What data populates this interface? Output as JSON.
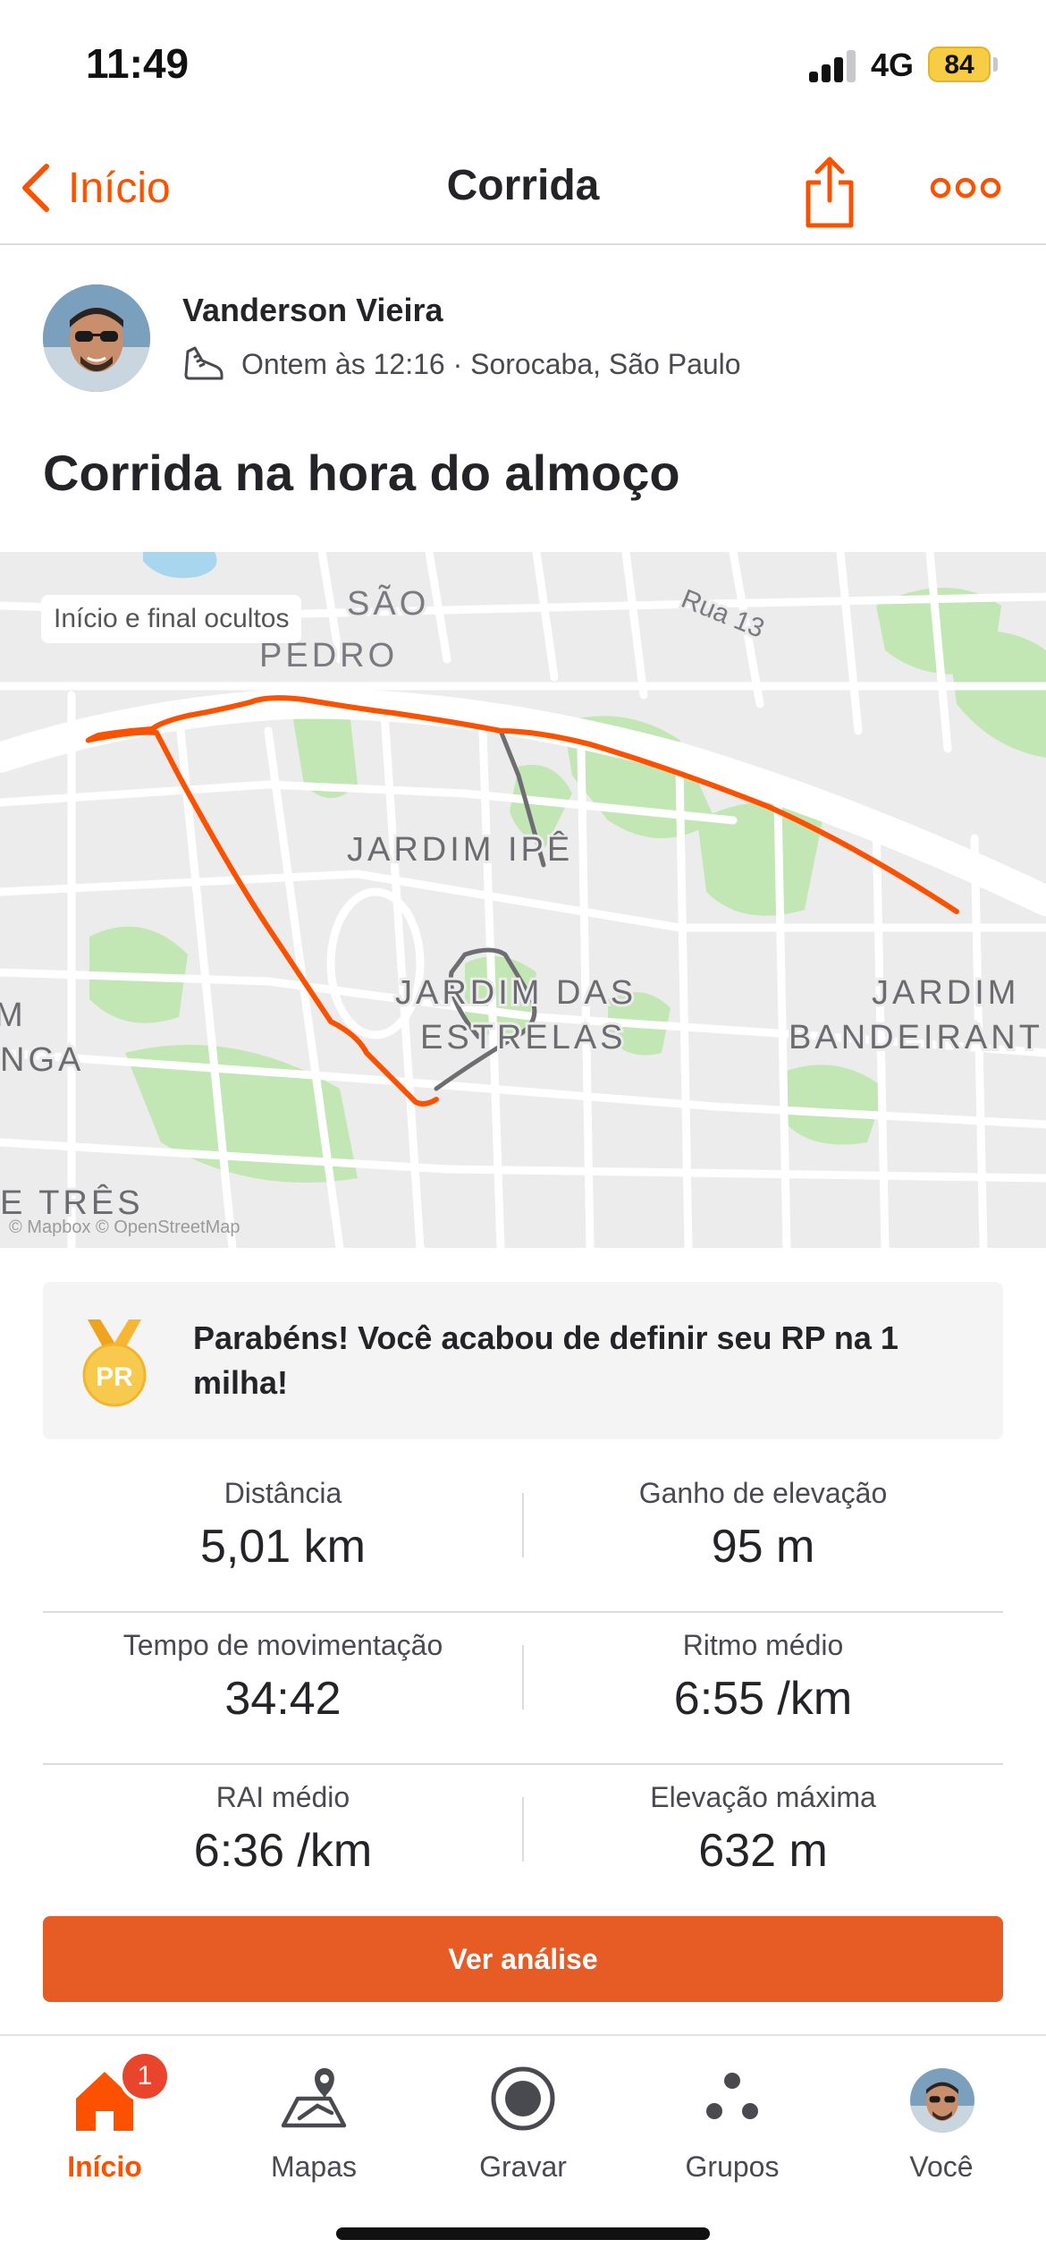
{
  "status_bar": {
    "time": "11:49",
    "network": "4G",
    "battery": "84"
  },
  "nav": {
    "back_label": "Início",
    "title": "Corrida"
  },
  "athlete": {
    "name": "Vanderson Vieira",
    "meta": "Ontem às 12:16 · Sorocaba, São Paulo"
  },
  "activity": {
    "title": "Corrida na hora do almoço"
  },
  "map": {
    "tag": "Início e final ocultos",
    "attribution": "© Mapbox © OpenStreetMap",
    "labels": [
      "SÃO",
      "PEDRO",
      "Rua 13",
      "JARDIM IPÊ",
      "JARDIM DAS",
      "ESTRELAS",
      "JARDIM",
      "BANDEIRANT",
      "M",
      "NGA",
      "E TRÊS"
    ],
    "route_color": "#fc5200"
  },
  "pr": {
    "badge_text": "PR",
    "message": "Parabéns! Você acabou de definir seu RP na 1 milha!"
  },
  "stats": [
    [
      {
        "label": "Distância",
        "value": "5,01 km"
      },
      {
        "label": "Ganho de elevação",
        "value": "95 m"
      }
    ],
    [
      {
        "label": "Tempo de movimentação",
        "value": "34:42"
      },
      {
        "label": "Ritmo médio",
        "value": "6:55 /km"
      }
    ],
    [
      {
        "label": "RAI médio",
        "value": "6:36 /km"
      },
      {
        "label": "Elevação máxima",
        "value": "632 m"
      }
    ]
  ],
  "cta": {
    "label": "Ver análise"
  },
  "tabs": [
    {
      "label": "Início",
      "icon": "home-icon",
      "badge": "1"
    },
    {
      "label": "Mapas",
      "icon": "maps-icon"
    },
    {
      "label": "Gravar",
      "icon": "record-icon"
    },
    {
      "label": "Grupos",
      "icon": "groups-icon"
    },
    {
      "label": "Você",
      "icon": "avatar"
    }
  ],
  "colors": {
    "accent": "#fc5200",
    "cta": "#e75b24",
    "badge": "#e8452c"
  }
}
